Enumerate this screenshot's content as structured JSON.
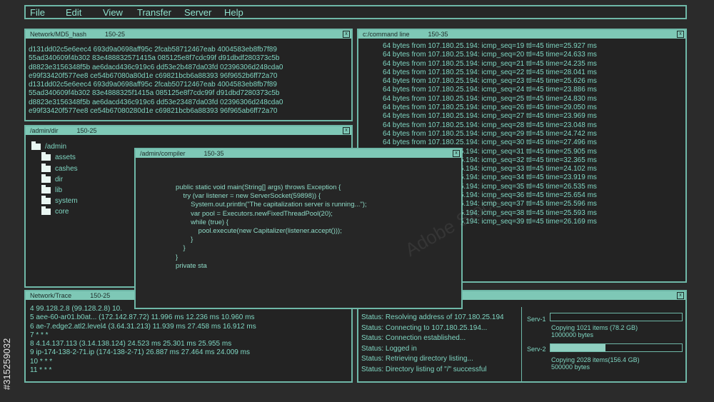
{
  "menu": [
    "File",
    "Edit",
    "View",
    "Transfer",
    "Server",
    "Help"
  ],
  "windows": {
    "md5": {
      "title": "Network/MD5_hash",
      "id": "150-25",
      "lines": [
        "d131dd02c5e6eec4 693d9a0698aff95c 2fcab58712467eab 4004583eb8fb7f89",
        "55ad340609f4b302 83e488832571415a 085125e8f7cdc99f d91dbdf280373c5b",
        "d8823e3156348f5b ae6dacd436c919c6 dd53e2b487da03fd 02396306d248cda0",
        "e99f33420f577ee8 ce54b67080a80d1e c69821bcb6a88393 96f9652b6ff72a70",
        "d131dd02c5e6eec4 693d9a0698aff95c 2fcab50712467eab 4004583eb8fb7f89",
        "55ad340609f4b302 83e4888325f1415a 085125e8f7cdc99f d91dbd7280373c5b",
        "d8823e3156348f5b ae6dacd436c919c6 dd53e23487da03fd 02396306d248cda0",
        "e99f33420f577ee8 ce54b67080280d1e c69821bcb6a88393 96f965ab6ff72a70"
      ]
    },
    "cmd": {
      "title": "c:/command line",
      "id": "150-35",
      "lines": [
        "64 bytes from 107.180.25.194: icmp_seq=19 ttl=45 time=25.927 ms",
        "64 bytes from 107.180.25.194: icmp_seq=20 ttl=45 time=24.633 ms",
        "64 bytes from 107.180.25.194: icmp_seq=21 ttl=45 time=24.235 ms",
        "64 bytes from 107.180.25.194: icmp_seq=22 ttl=45 time=28.041 ms",
        "64 bytes from 107.180.25.194: icmp_seq=23 ttl=45 time=25.626 ms",
        "64 bytes from 107.180.25.194: icmp_seq=24 ttl=45 time=23.886 ms",
        "64 bytes from 107.180.25.194: icmp_seq=25 ttl=45 time=24.830 ms",
        "64 bytes from 107.180.25.194: icmp_seq=26 ttl=45 time=29.050 ms",
        "64 bytes from 107.180.25.194: icmp_seq=27 ttl=45 time=23.969 ms",
        "64 bytes from 107.180.25.194: icmp_seq=28 ttl=45 time=23.048 ms",
        "64 bytes from 107.180.25.194: icmp_seq=29 ttl=45 time=24.742 ms",
        "64 bytes from 107.180.25.194: icmp_seq=30 ttl=45 time=27.496 ms",
        "64 bytes from 107.180.25.194: icmp_seq=31 ttl=45 time=25.905 ms",
        "64 bytes from 107.180.25.194: icmp_seq=32 ttl=45 time=32.365 ms",
        "64 bytes from 107.180.25.194: icmp_seq=33 ttl=45 time=24.102 ms",
        "64 bytes from 107.180.25.194: icmp_seq=34 ttl=45 time=23.919 ms",
        "64 bytes from 107.180.25.194: icmp_seq=35 ttl=45 time=26.535 ms",
        "64 bytes from 107.180.25.194: icmp_seq=36 ttl=45 time=25.654 ms",
        "64 bytes from 107.180.25.194: icmp_seq=37 ttl=45 time=25.596 ms",
        "64 bytes from 107.180.25.194: icmp_seq=38 ttl=45 time=25.593 ms",
        "64 bytes from 107.180.25.194: icmp_seq=39 ttl=45 time=26.169 ms"
      ]
    },
    "dir": {
      "title": "/admin/dir",
      "id": "150-25",
      "root": "/admin",
      "items": [
        "assets",
        "cashes",
        "dir",
        "lib",
        "system",
        "core"
      ]
    },
    "compiler": {
      "title": "/admin/compiler",
      "id": "150-35",
      "code": [
        "public static void main(String[] args) throws Exception {",
        "    try (var listener = new ServerSocket(59898)) {",
        "        System.out.println(\"The capitalization server is running...\");",
        "        var pool = Executors.newFixedThreadPool(20);",
        "        while (true) {",
        "            pool.execute(new Capitalizer(listener.accept()));",
        "        }",
        "    }",
        "}",
        "",
        "private sta"
      ]
    },
    "trace": {
      "title": "Network/Trace",
      "id": "150-25",
      "lines": [
        "4  99.128.2.8 (99.128.2.8)  10.",
        "5  aee-60-ar01.b0at... (172.142.87.72)  11.996 ms  12.236 ms  10.960 ms",
        "6  ae-7.edge2.atl2.level4 (3.64.31.213)  11.939 ms  27.458 ms  16.912 ms",
        "7  * * *",
        "8  4.14.137.113 (3.14.138.124)  24.523 ms  25.301 ms  25.955 ms",
        "9  ip-174-138-2-71.ip (174-138-2-71)  26.887 ms  27.464 ms  24.009 ms",
        "10  * * *",
        "11  * * *"
      ]
    },
    "status": {
      "lines": [
        "Status: Resolving address of 107.180.25.194",
        "Status: Connecting to 107.180.25.194...",
        "Status: Connection established...",
        "Status: Logged in",
        "Status: Retrieving directory listing...",
        "Status: Directory listing of \"/\" successful"
      ],
      "servers": [
        {
          "name": "Serv-1",
          "copy": "Copying  1021 items (78.2 GB)",
          "bytes": "1000000 bytes",
          "progress": 0
        },
        {
          "name": "Serv-2",
          "copy": "Copying  2028 items(156.4 GB)",
          "bytes": "500000 bytes",
          "progress": 0.42
        }
      ]
    }
  },
  "watermark": {
    "side_id": "#315259032",
    "brand": "Adobe Stock"
  },
  "colors": {
    "accent": "#7ec8b6",
    "background": "#2b2b2b",
    "text": "#7fd6c2"
  }
}
